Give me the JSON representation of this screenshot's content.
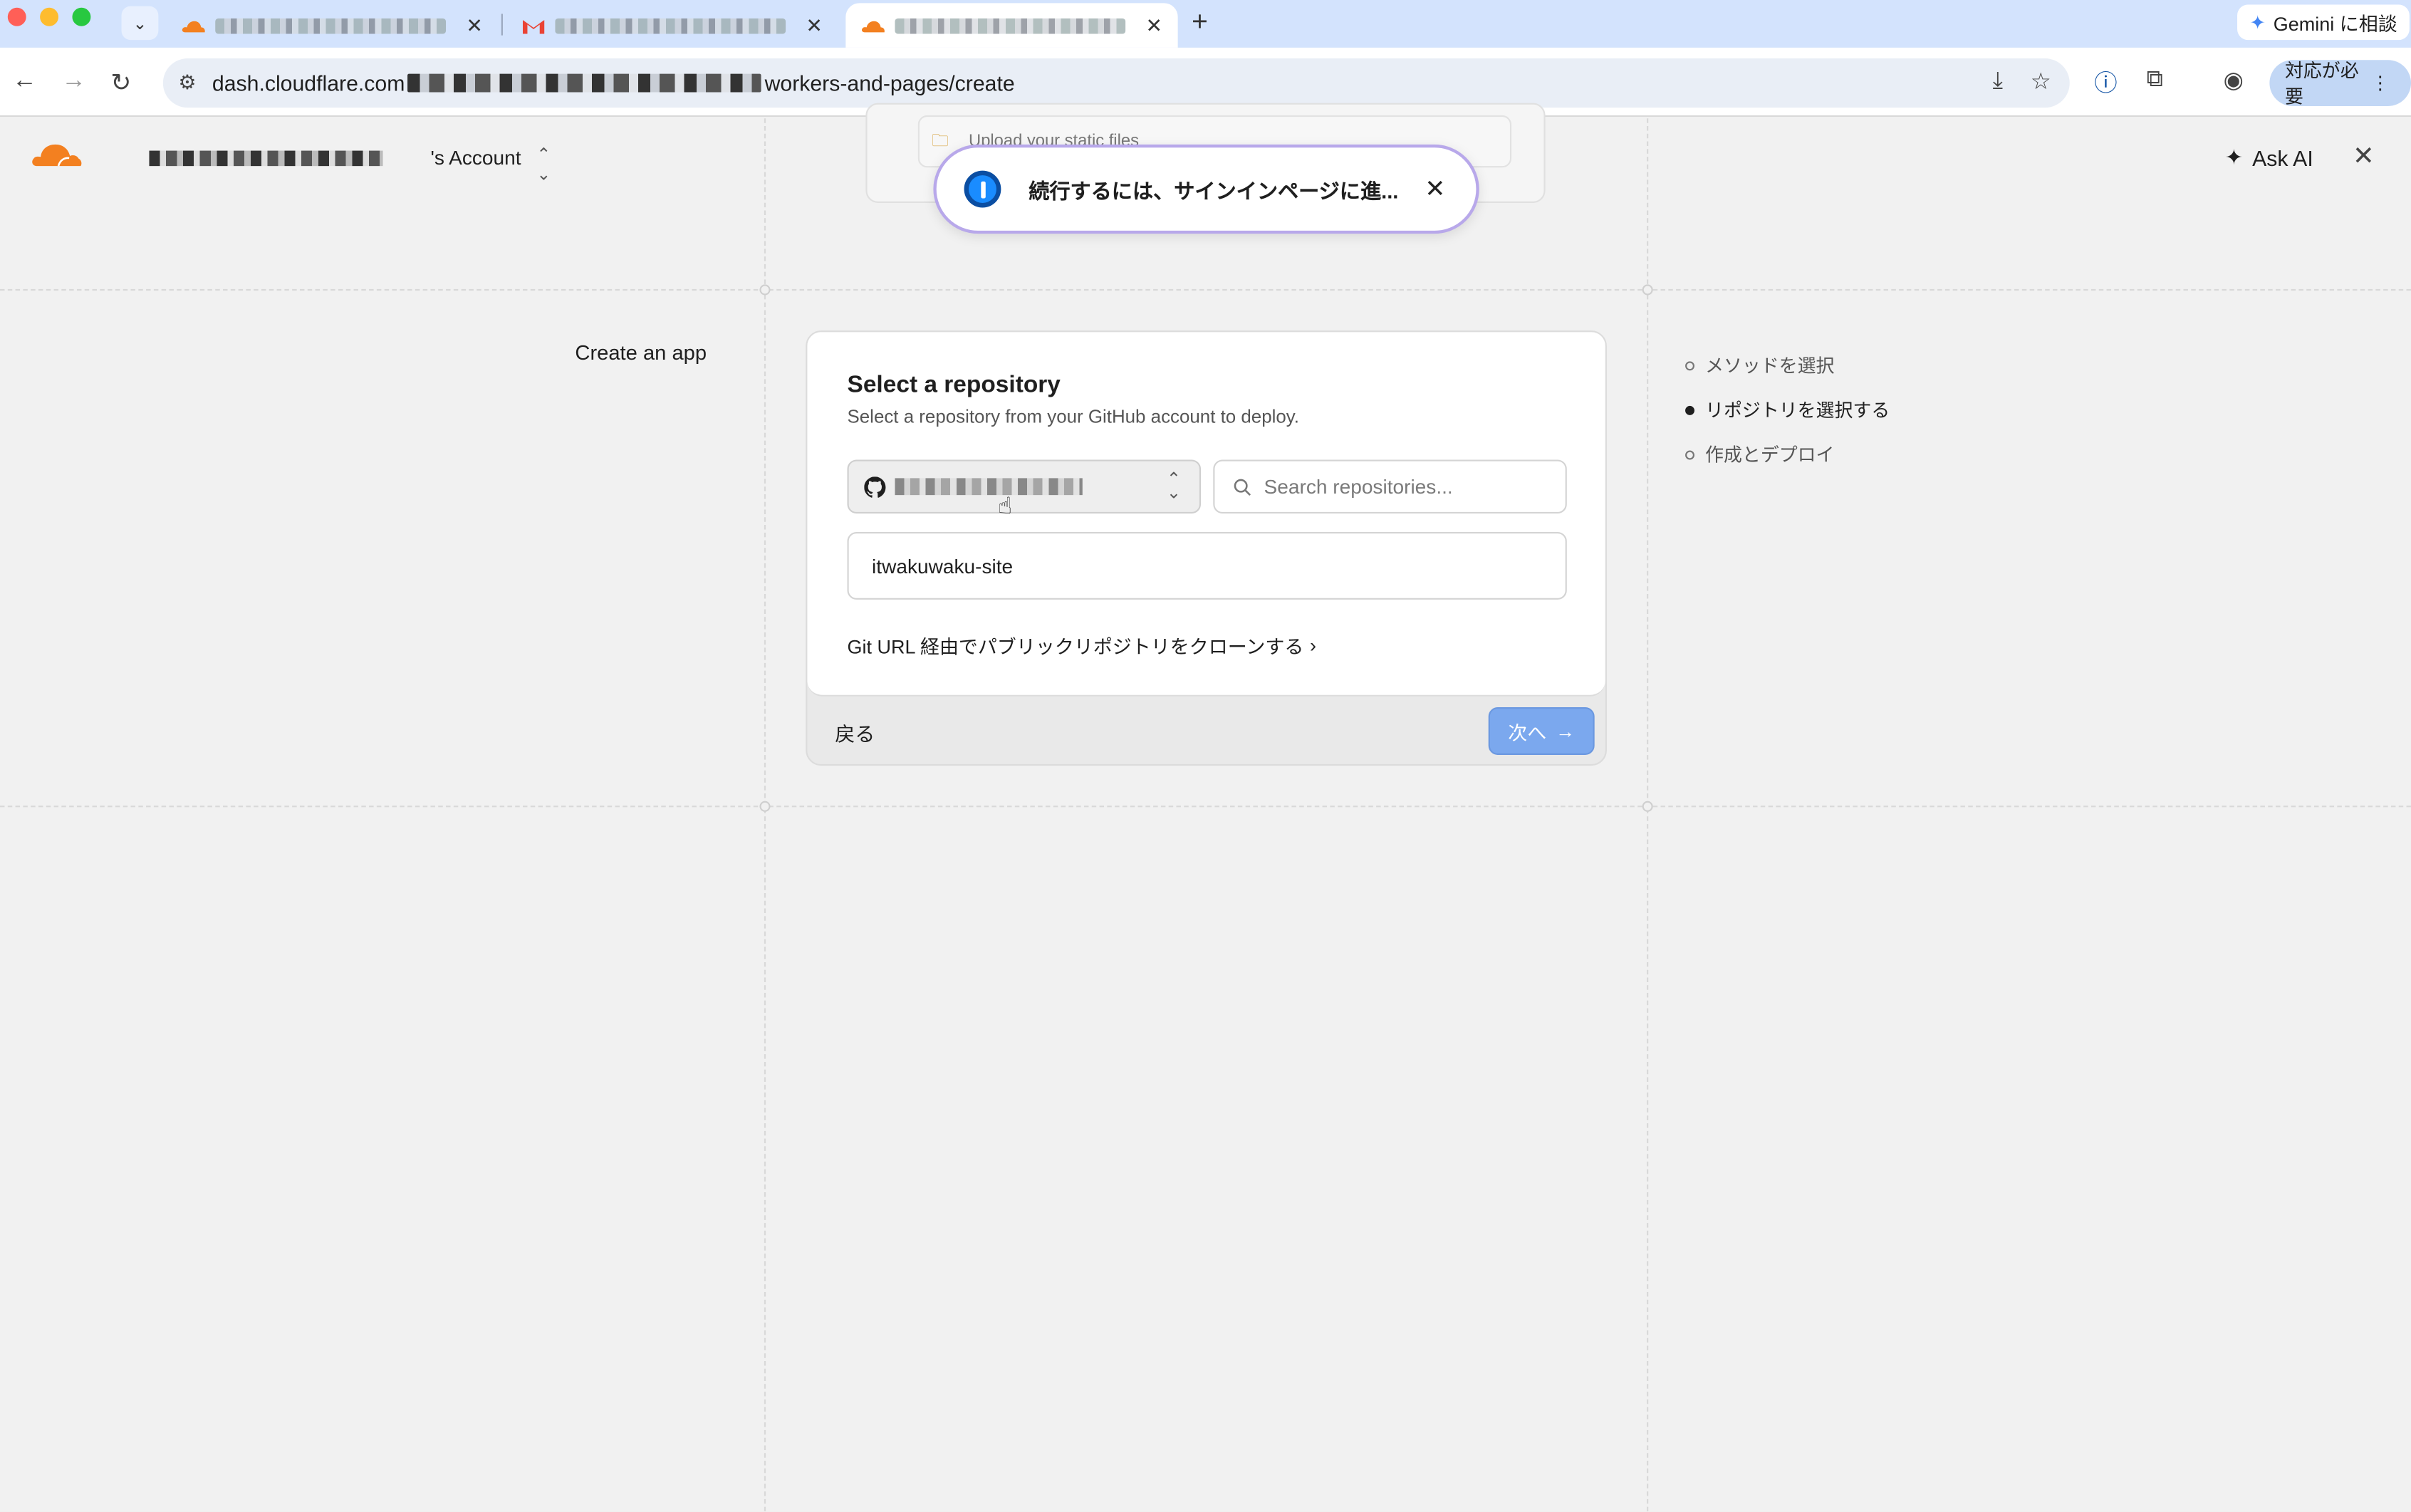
{
  "browser": {
    "tabs": [
      {
        "title": "",
        "active": false
      },
      {
        "title": "",
        "active": false
      },
      {
        "title": "",
        "active": true
      }
    ],
    "gemini_label": "Gemini に相談",
    "url_prefix": "dash.cloudflare.com",
    "url_suffix": "workers-and-pages/create",
    "update_label": "対応が必要"
  },
  "header": {
    "account_label": "'s Account",
    "ask_ai_label": "Ask AI"
  },
  "background": {
    "upload_label": "Upload your static files"
  },
  "password_popup": {
    "message": "続行するには、サインインページに進..."
  },
  "sidebar_title": "Create an app",
  "card": {
    "title": "Select a repository",
    "subtitle": "Select a repository from your GitHub account to deploy.",
    "search_placeholder": "Search repositories...",
    "repository": "itwakuwaku-site",
    "clone_link": "Git URL 経由でパブリックリポジトリをクローンする",
    "back_label": "戻る",
    "next_label": "次へ"
  },
  "steps": [
    {
      "label": "メソッドを選択",
      "active": false
    },
    {
      "label": "リポジトリを選択する",
      "active": true
    },
    {
      "label": "作成とデプロイ",
      "active": false
    }
  ],
  "colors": {
    "accent": "#7ba8ee",
    "cloudflare_orange": "#f38020",
    "popup_border": "#b8a8ea"
  }
}
